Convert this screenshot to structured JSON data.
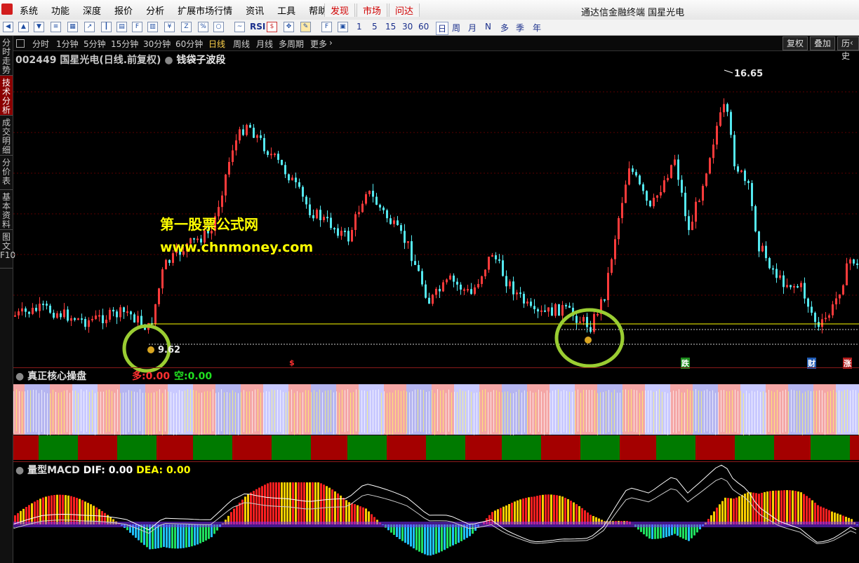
{
  "menu": {
    "items": [
      "系统",
      "功能",
      "深度",
      "报价",
      "分析",
      "扩展市场行情",
      "资讯",
      "工具",
      "帮助"
    ],
    "hot_items": [
      "发现",
      "市场",
      "问达"
    ]
  },
  "window_title": "通达信金融终端  国星光电",
  "toolbar": {
    "periods": [
      "1",
      "5",
      "15",
      "30",
      "60",
      "日",
      "周",
      "月",
      "N",
      "多",
      "季",
      "年"
    ]
  },
  "left_tabs": [
    "分时走势",
    "技术分析",
    "成交明细",
    "分价表",
    "基本资料",
    "图文F10"
  ],
  "period_bar": {
    "items": [
      "分时",
      "1分钟",
      "5分钟",
      "15分钟",
      "30分钟",
      "60分钟",
      "日线",
      "周线",
      "月线",
      "多周期",
      "更多"
    ],
    "selected": "日线",
    "right_buttons": [
      "复权",
      "叠加",
      "历史"
    ]
  },
  "main": {
    "stock_code": "002449",
    "stock_name": "国星光电",
    "chart_kind": "(日线.前复权)",
    "indicator": "钱袋子波段",
    "peak_price": "16.65",
    "low_price": "9.62",
    "watermark_line1": "第一股票公式网",
    "watermark_line2": "www.chnmoney.com",
    "markers": [
      "$",
      "跌",
      "财",
      "涨"
    ]
  },
  "panel2": {
    "title": "真正核心操盘",
    "duo_label": "多:",
    "duo_value": "0.00",
    "kong_label": "空:",
    "kong_value": "0.00"
  },
  "panel3": {
    "title": "量型MACD",
    "dif_label": "DIF:",
    "dif_value": "0.00",
    "dea_label": "DEA:",
    "dea_value": "0.00"
  },
  "colors": {
    "up": "#ff3b3b",
    "down": "#54e8f0",
    "yellow": "#ffff00",
    "green_circle": "#9acd32",
    "dark_red_bar": "#a40000",
    "dark_green_bar": "#007a00"
  }
}
